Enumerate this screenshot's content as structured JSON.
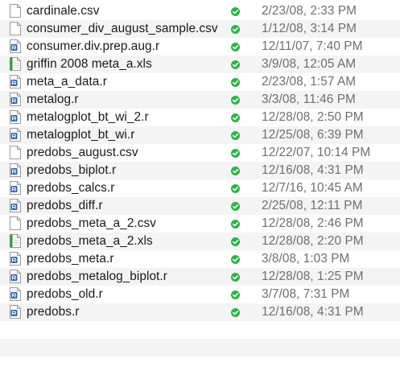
{
  "files": [
    {
      "name": "cardinale.csv",
      "date": "2/23/08, 2:33 PM",
      "icon": "csv-file-icon",
      "status_icon": "synced-check-icon"
    },
    {
      "name": "consumer_div_august_sample.csv",
      "date": "1/12/08, 3:14 PM",
      "icon": "csv-file-icon",
      "status_icon": "synced-check-icon"
    },
    {
      "name": "consumer.div.prep.aug.r",
      "date": "12/11/07, 7:40 PM",
      "icon": "r-script-file-icon",
      "status_icon": "synced-check-icon"
    },
    {
      "name": "griffin 2008 meta_a.xls",
      "date": "3/9/08, 12:05 AM",
      "icon": "xls-file-icon",
      "status_icon": "synced-check-icon"
    },
    {
      "name": "meta_a_data.r",
      "date": "2/23/08, 1:57 AM",
      "icon": "r-script-file-icon",
      "status_icon": "synced-check-icon"
    },
    {
      "name": "metalog.r",
      "date": "3/3/08, 11:46 PM",
      "icon": "r-script-file-icon",
      "status_icon": "synced-check-icon"
    },
    {
      "name": "metalogplot_bt_wi_2.r",
      "date": "12/28/08, 2:50 PM",
      "icon": "r-script-file-icon",
      "status_icon": "synced-check-icon"
    },
    {
      "name": "metalogplot_bt_wi.r",
      "date": "12/25/08, 6:39 PM",
      "icon": "r-script-file-icon",
      "status_icon": "synced-check-icon"
    },
    {
      "name": "predobs_august.csv",
      "date": "12/22/07, 10:14 PM",
      "icon": "csv-file-icon",
      "status_icon": "synced-check-icon"
    },
    {
      "name": "predobs_biplot.r",
      "date": "12/16/08, 4:31 PM",
      "icon": "r-script-file-icon",
      "status_icon": "synced-check-icon"
    },
    {
      "name": "predobs_calcs.r",
      "date": "12/7/16, 10:45 AM",
      "icon": "r-script-file-icon",
      "status_icon": "synced-check-icon"
    },
    {
      "name": "predobs_diff.r",
      "date": "2/25/08, 12:11 PM",
      "icon": "r-script-file-icon",
      "status_icon": "synced-check-icon"
    },
    {
      "name": "predobs_meta_a_2.csv",
      "date": "12/28/08, 2:46 PM",
      "icon": "csv-file-icon",
      "status_icon": "synced-check-icon"
    },
    {
      "name": "predobs_meta_a_2.xls",
      "date": "12/28/08, 2:20 PM",
      "icon": "xls-file-icon",
      "status_icon": "synced-check-icon"
    },
    {
      "name": "predobs_meta.r",
      "date": "3/8/08, 1:03 PM",
      "icon": "r-script-file-icon",
      "status_icon": "synced-check-icon"
    },
    {
      "name": "predobs_metalog_biplot.r",
      "date": "12/28/08, 1:25 PM",
      "icon": "r-script-file-icon",
      "status_icon": "synced-check-icon"
    },
    {
      "name": "predobs_old.r",
      "date": "3/7/08, 7:31 PM",
      "icon": "r-script-file-icon",
      "status_icon": "synced-check-icon"
    },
    {
      "name": "predobs.r",
      "date": "12/16/08, 4:31 PM",
      "icon": "r-script-file-icon",
      "status_icon": "synced-check-icon"
    }
  ],
  "colors": {
    "row_alt": "#f4f4f4",
    "name_text": "#1a1a1a",
    "date_text": "#6e6e6e",
    "synced_green": "#2fb24a",
    "r_icon_blue": "#2f5fa8",
    "xls_icon_green": "#2e9a3c"
  }
}
